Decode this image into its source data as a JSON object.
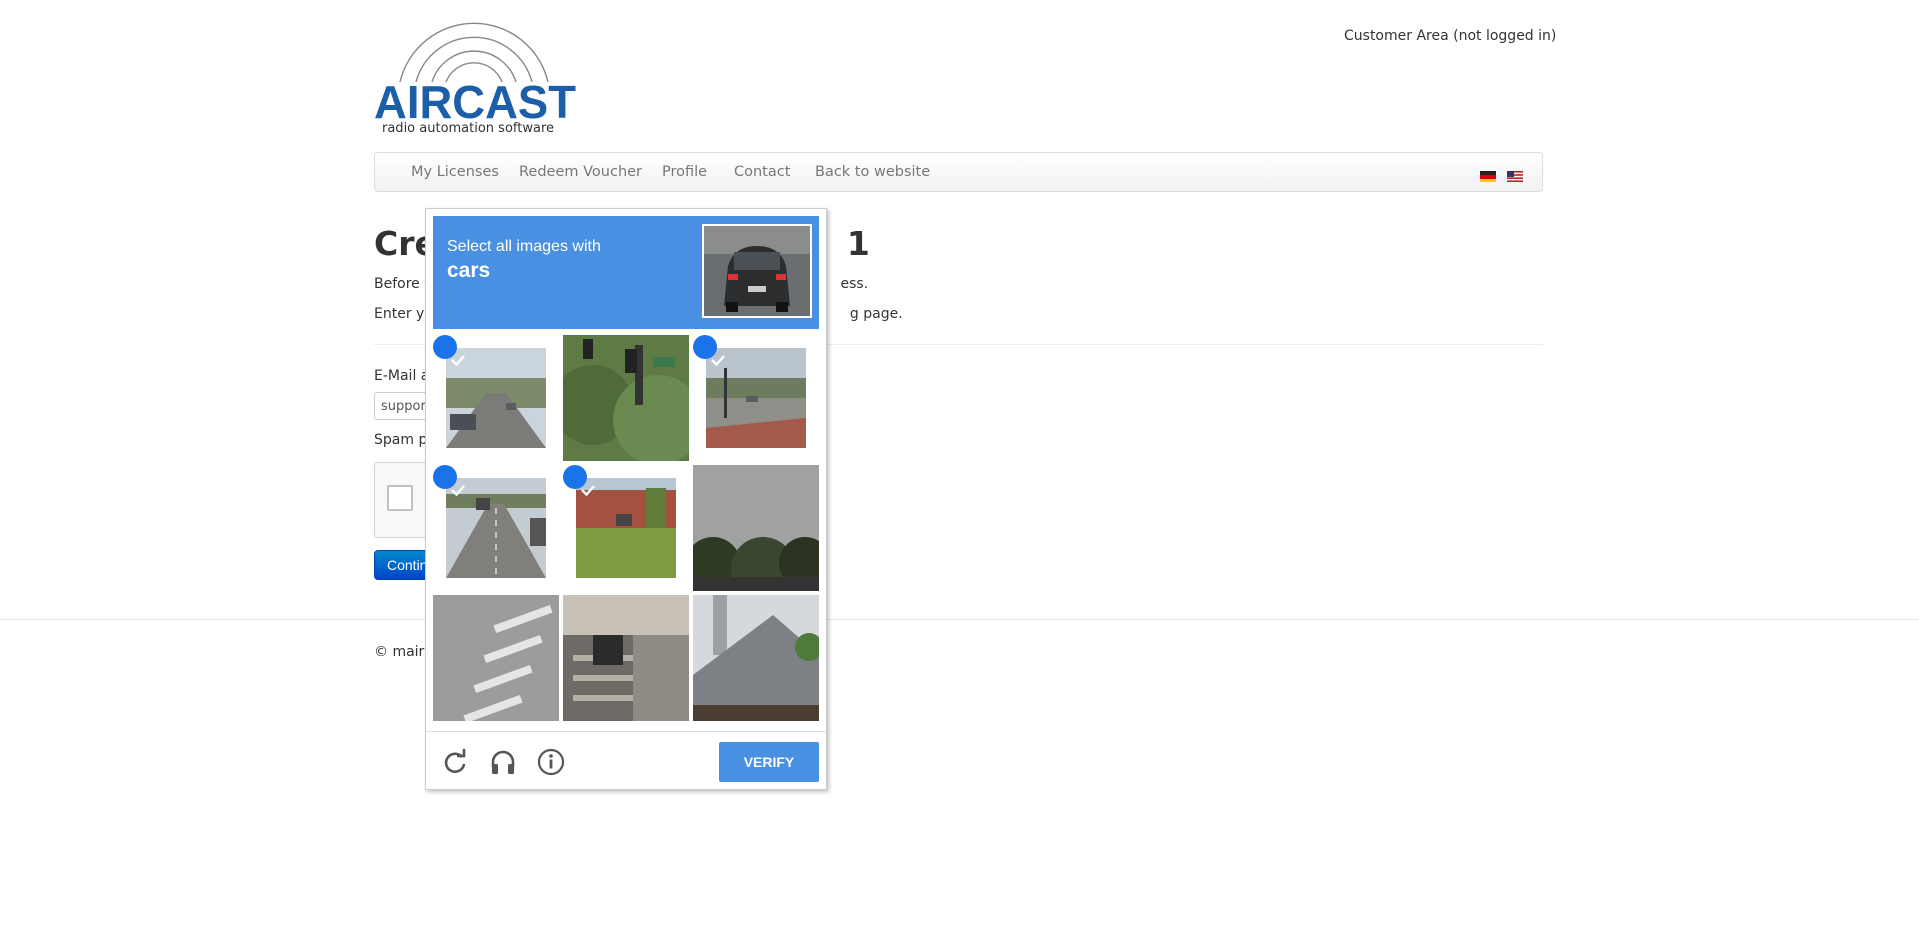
{
  "header": {
    "logo_text": "AIRCAST",
    "logo_tagline": "radio automation software",
    "customer_area": "Customer Area (not logged in)"
  },
  "nav": {
    "items": [
      "My Licenses",
      "Redeem Voucher",
      "Profile",
      "Contact",
      "Back to website"
    ],
    "flags": [
      "german-flag-icon",
      "us-flag-icon"
    ]
  },
  "main": {
    "title_left": "Cre",
    "title_right": "1",
    "line1_left": "Before y",
    "line1_right": "ess.",
    "line2_left": "Enter yo",
    "line2_right": "g page.",
    "email_label": "E-Mail a",
    "email_value": "suppor",
    "spam_label": "Spam p",
    "continue_label": "Contin"
  },
  "footer": {
    "copyright": "© mairl"
  },
  "captcha": {
    "instruction": "Select all images with",
    "target": "cars",
    "verify_label": "VERIFY",
    "icons": [
      "reload-icon",
      "audio-icon",
      "info-icon"
    ],
    "tiles": [
      {
        "scene": "road-with-cars",
        "selected": true
      },
      {
        "scene": "trees-traffic-light",
        "selected": false
      },
      {
        "scene": "intersection",
        "selected": true
      },
      {
        "scene": "highway-with-cars",
        "selected": true
      },
      {
        "scene": "building-lawn-car",
        "selected": true
      },
      {
        "scene": "trees-sky",
        "selected": false
      },
      {
        "scene": "crosswalk",
        "selected": false
      },
      {
        "scene": "stairs-house",
        "selected": false
      },
      {
        "scene": "roof-pole",
        "selected": false
      }
    ],
    "check_color": "#1a73e8",
    "accent_color": "#4a90e2"
  }
}
